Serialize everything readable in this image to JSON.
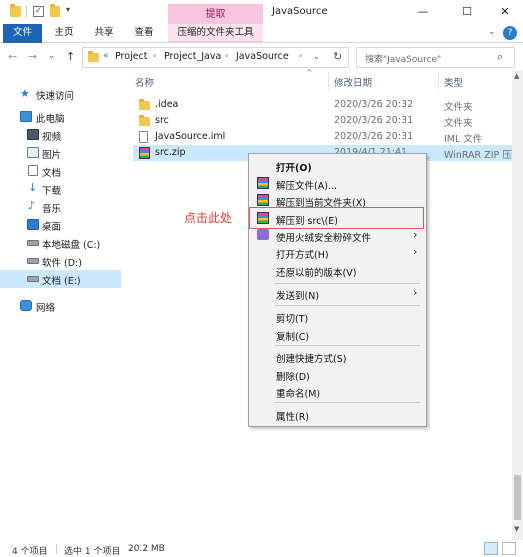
{
  "window": {
    "title": "JavaSource",
    "context_tab_header": "提取",
    "minimize_glyph": "—",
    "maximize_glyph": "☐",
    "close_glyph": "✕",
    "quick_access_dropdown": "▾"
  },
  "ribbon": {
    "tabs": [
      "文件",
      "主页",
      "共享",
      "查看",
      "压缩的文件夹工具"
    ],
    "expand_glyph": "⌄",
    "help_glyph": "?"
  },
  "nav_buttons": {
    "back": "←",
    "forward": "→",
    "recent": "⌄",
    "up": "↑"
  },
  "address": {
    "prefix": "«",
    "crumbs": [
      "Project",
      "Project_Java",
      "JavaSource"
    ],
    "separator": "›",
    "dropdown_glyph": "⌄",
    "refresh_glyph": "↻"
  },
  "search": {
    "placeholder": "搜索\"JavaSource\"",
    "icon_glyph": "⌕"
  },
  "nav_pane": {
    "items": [
      {
        "label": "快速访问",
        "icon": "star-icon"
      },
      {
        "label": "此电脑",
        "icon": "pc-icon"
      },
      {
        "label": "视频",
        "icon": "video-icon"
      },
      {
        "label": "图片",
        "icon": "picture-icon"
      },
      {
        "label": "文档",
        "icon": "document-icon"
      },
      {
        "label": "下载",
        "icon": "download-icon"
      },
      {
        "label": "音乐",
        "icon": "music-icon"
      },
      {
        "label": "桌面",
        "icon": "desktop-icon"
      },
      {
        "label": "本地磁盘 (C:)",
        "icon": "drive-icon"
      },
      {
        "label": "软件 (D:)",
        "icon": "drive-icon"
      },
      {
        "label": "文档 (E:)",
        "icon": "drive-icon",
        "selected": true
      },
      {
        "label": "网络",
        "icon": "network-icon"
      }
    ]
  },
  "columns": {
    "name": "名称",
    "modified": "修改日期",
    "type": "类型",
    "sort_glyph": "^"
  },
  "files": [
    {
      "name": ".idea",
      "date": "2020/3/26 20:32",
      "type": "文件夹",
      "icon": "folder-icon"
    },
    {
      "name": "src",
      "date": "2020/3/26 20:31",
      "type": "文件夹",
      "icon": "folder-icon"
    },
    {
      "name": "JavaSource.iml",
      "date": "2020/3/26 20:31",
      "type": "IML 文件",
      "icon": "file-icon"
    },
    {
      "name": "src.zip",
      "date": "2019/4/1 21:41",
      "type": "WinRAR ZIP 压缩...",
      "icon": "winrar-icon",
      "selected": true
    }
  ],
  "context_menu": {
    "open": "打开(O)",
    "extract_files": "解压文件(A)...",
    "extract_here": "解压到当前文件夹(X)",
    "extract_to": "解压到 src\\(E)",
    "shred": "使用火绒安全粉碎文件",
    "open_with": "打开方式(H)",
    "restore": "还原以前的版本(V)",
    "send_to": "发送到(N)",
    "cut": "剪切(T)",
    "copy": "复制(C)",
    "create_shortcut": "创建快捷方式(S)",
    "delete": "删除(D)",
    "rename": "重命名(M)",
    "properties": "属性(R)",
    "submenu_glyph": "›"
  },
  "annotation": {
    "text": "点击此处",
    "color": "#e53935"
  },
  "status": {
    "item_count": "4 个项目",
    "selection": "选中 1 个项目",
    "size": "20.2 MB"
  },
  "colors": {
    "accent": "#1f63b5",
    "selection": "#cce8ff",
    "context_tab": "#f7c5e0"
  }
}
